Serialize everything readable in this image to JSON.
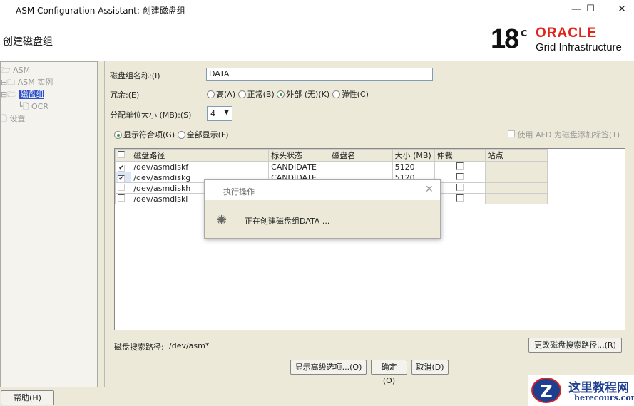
{
  "window": {
    "title": "ASM Configuration Assistant:  创建磁盘组",
    "minimize": "—",
    "maximize": "☐",
    "close": "✕"
  },
  "header": {
    "page_title": "创建磁盘组",
    "logo_version": "18",
    "logo_c": "c",
    "logo_brand": "ORACLE",
    "logo_product": "Grid Infrastructure"
  },
  "tree": {
    "root": "ASM",
    "instances": "ASM 实例",
    "diskgroups": "磁盘组",
    "ocr": "OCR",
    "settings": "设置"
  },
  "form": {
    "name_label": "磁盘组名称:(I)",
    "name_value": "DATA",
    "redundancy_label": "冗余:(E)",
    "redundancy_options": [
      "高(A)",
      "正常(B)",
      "外部 (无)(K)",
      "弹性(C)"
    ],
    "redundancy_selected": "外部 (无)(K)",
    "au_label": "分配单位大小 (MB):(S)",
    "au_value": "4",
    "show_eligible": "显示符合项(G)",
    "show_all": "全部显示(F)",
    "afd_label": "使用 AFD 为磁盘添加标签(T)"
  },
  "table": {
    "headers": [
      "磁盘路径",
      "标头状态",
      "磁盘名",
      "大小 (MB)",
      "仲裁",
      "站点"
    ],
    "rows": [
      {
        "checked": true,
        "path": "/dev/asmdiskf",
        "status": "CANDIDATE",
        "name": "",
        "size": "5120"
      },
      {
        "checked": true,
        "path": "/dev/asmdiskg",
        "status": "CANDIDATE",
        "name": "",
        "size": "5120"
      },
      {
        "checked": false,
        "path": "/dev/asmdiskh",
        "status": "",
        "name": "",
        "size": ""
      },
      {
        "checked": false,
        "path": "/dev/asmdiski",
        "status": "",
        "name": "",
        "size": ""
      }
    ]
  },
  "discovery": {
    "label": "磁盘搜索路径:",
    "value": "/dev/asm*",
    "change_button": "更改磁盘搜索路径...(R)"
  },
  "buttons": {
    "advanced": "显示高级选项...(O)",
    "ok": "确定(O)",
    "cancel": "取消(D)",
    "help": "帮助(H)"
  },
  "dialog": {
    "title": "执行操作",
    "message": "正在创建磁盘组DATA ...",
    "close": "✕"
  },
  "watermark": {
    "name": "这里教程网",
    "url": "herecours.com"
  }
}
